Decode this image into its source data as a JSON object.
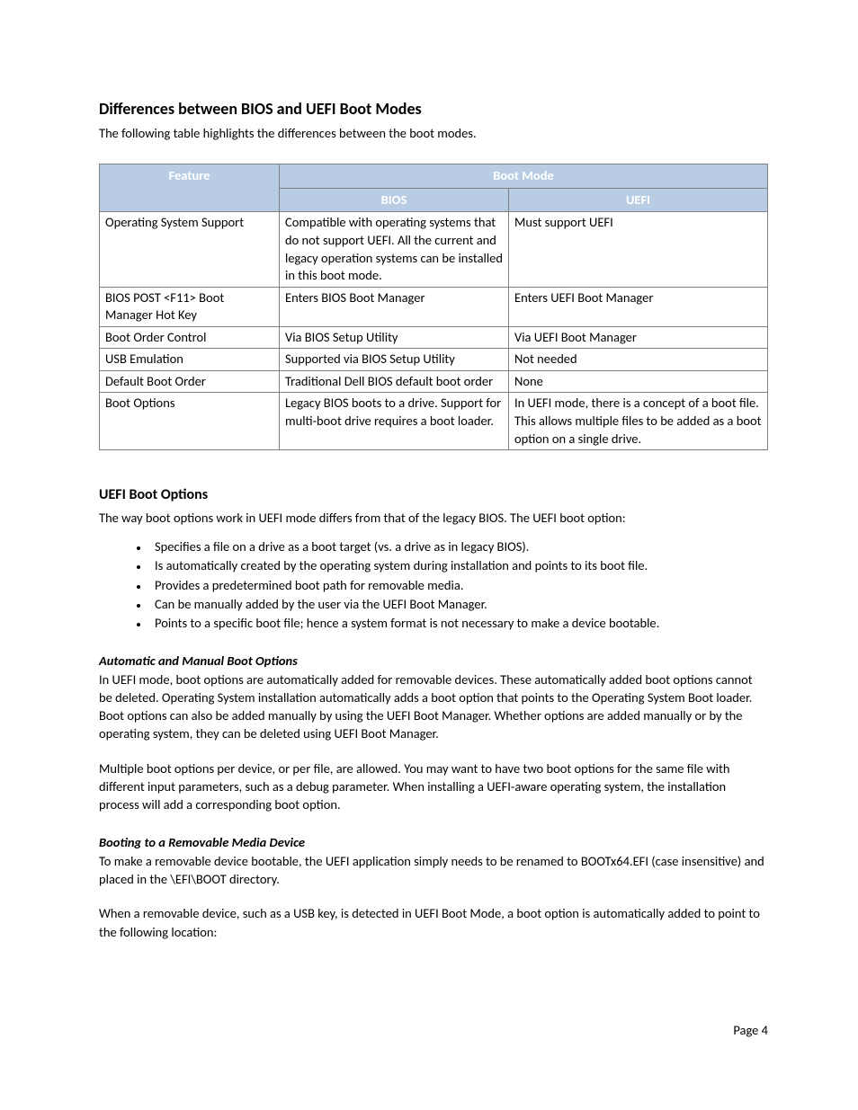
{
  "section1": {
    "heading": "Differences between BIOS and UEFI Boot Modes",
    "intro": "The following table highlights the differences between the boot modes."
  },
  "table": {
    "head": {
      "feature": "Feature",
      "bootmode": "Boot Mode",
      "bios": "BIOS",
      "uefi": "UEFI"
    },
    "rows": [
      {
        "feature": "Operating System Support",
        "bios": "Compatible with operating systems that do not support UEFI. All the current and legacy operation systems can be installed in this boot mode.",
        "uefi": "Must support UEFI"
      },
      {
        "feature": "BIOS POST <F11> Boot Manager Hot Key",
        "bios": "Enters BIOS Boot Manager",
        "uefi": "Enters UEFI Boot Manager"
      },
      {
        "feature": "Boot Order Control",
        "bios": "Via BIOS Setup Utility",
        "uefi": "Via UEFI Boot Manager"
      },
      {
        "feature": "USB Emulation",
        "bios": "Supported via BIOS Setup Utility",
        "uefi": "Not needed"
      },
      {
        "feature": "Default Boot Order",
        "bios": "Traditional Dell BIOS default boot order",
        "uefi": "None"
      },
      {
        "feature": "Boot Options",
        "bios": "Legacy BIOS boots to a drive.  Support for multi-boot drive requires a boot loader.",
        "uefi": "In UEFI mode, there is a concept of a boot file.  This allows multiple files to be added as a boot option on a single drive."
      }
    ]
  },
  "section2": {
    "heading": "UEFI Boot Options",
    "intro": "The way boot options work in UEFI mode differs from that of the legacy BIOS.  The UEFI boot option:",
    "bullets": [
      "Specifies a file on a drive as a boot target (vs. a drive as in legacy BIOS).",
      "Is automatically created by the operating system during installation and points to its boot file.",
      "Provides a predetermined boot path for removable media.",
      "Can be manually added by the user via the UEFI Boot Manager.",
      "Points to a specific boot file; hence a system format is not necessary to make a device bootable."
    ],
    "sub1": {
      "heading": "Automatic and Manual Boot Options",
      "p1": "In UEFI mode, boot options are automatically added for removable devices.  These automatically added boot options cannot be deleted.  Operating System installation automatically adds a boot option that points to the Operating System Boot loader. Boot options can also be added manually by using the UEFI Boot Manager. Whether options are added manually or by the operating system, they can be deleted using UEFI Boot Manager.",
      "p2": " Multiple boot options per device, or per file, are allowed.  You may want to have two boot options for the same file with different input parameters, such as a debug parameter.  When installing a UEFI-aware operating system, the installation process will add a corresponding boot option."
    },
    "sub2": {
      "heading": "Booting to a Removable Media Device",
      "p1": "To make a removable device bootable, the UEFI application simply needs to be renamed to BOOTx64.EFI (case insensitive) and placed in the \\EFI\\BOOT directory.",
      "p2": "When a removable device, such as a USB key, is detected in UEFI Boot Mode, a boot option is automatically added to point to the following location:"
    }
  },
  "footer": {
    "page": "Page 4"
  }
}
